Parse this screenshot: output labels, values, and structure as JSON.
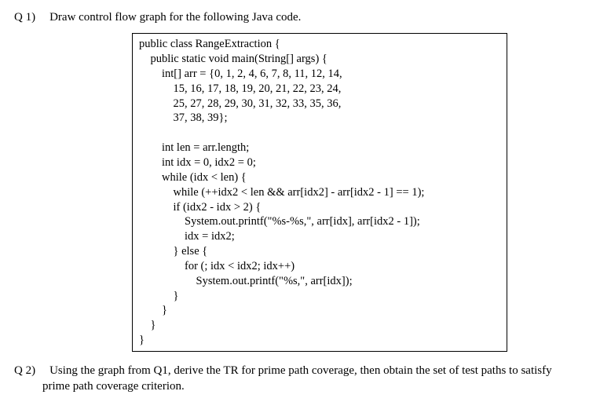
{
  "q1": {
    "label": "Q 1)",
    "prompt": "Draw control flow graph for the following Java code."
  },
  "code": {
    "l01": "public class RangeExtraction {",
    "l02": "    public static void main(String[] args) {",
    "l03": "        int[] arr = {0, 1, 2, 4, 6, 7, 8, 11, 12, 14,",
    "l04": "            15, 16, 17, 18, 19, 20, 21, 22, 23, 24,",
    "l05": "            25, 27, 28, 29, 30, 31, 32, 33, 35, 36,",
    "l06": "            37, 38, 39};",
    "l07": "",
    "l08": "        int len = arr.length;",
    "l09": "        int idx = 0, idx2 = 0;",
    "l10": "        while (idx < len) {",
    "l11": "            while (++idx2 < len && arr[idx2] - arr[idx2 - 1] == 1);",
    "l12": "            if (idx2 - idx > 2) {",
    "l13": "                System.out.printf(\"%s-%s,\", arr[idx], arr[idx2 - 1]);",
    "l14": "                idx = idx2;",
    "l15": "            } else {",
    "l16": "                for (; idx < idx2; idx++)",
    "l17": "                    System.out.printf(\"%s,\", arr[idx]);",
    "l18": "            }",
    "l19": "        }",
    "l20": "    }",
    "l21": "}"
  },
  "q2": {
    "label": "Q 2)",
    "prompt_part1": "Using the graph from Q1, derive the TR for prime path coverage, then obtain the set of test paths to satisfy",
    "prompt_part2": "prime path coverage criterion."
  }
}
